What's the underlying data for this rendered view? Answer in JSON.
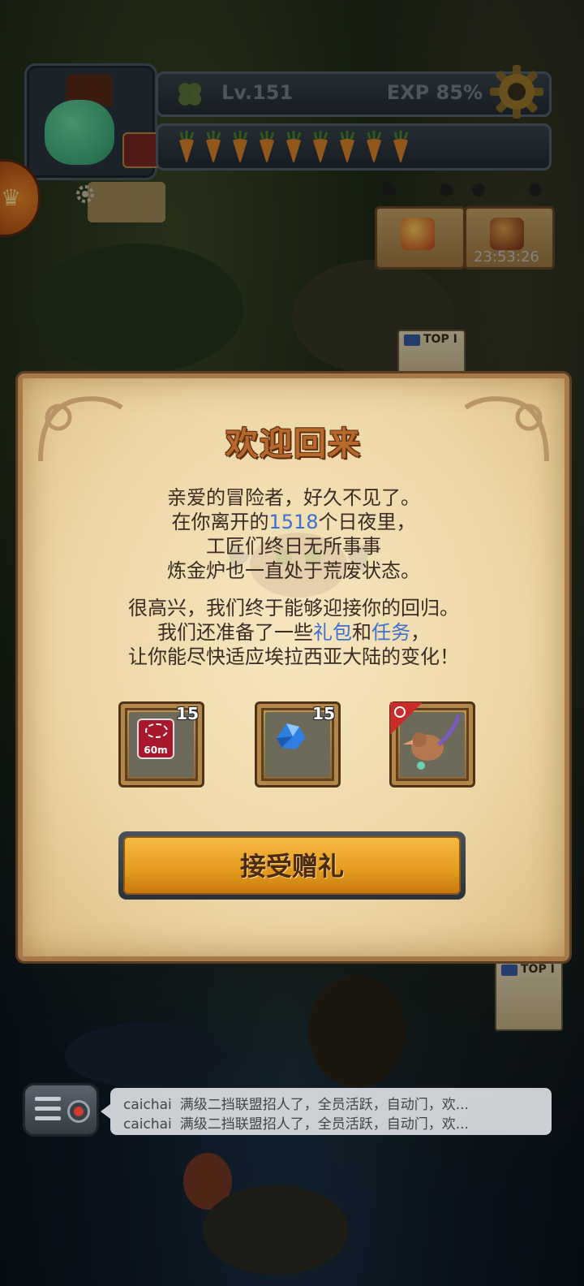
{
  "hud": {
    "level": "Lv.151",
    "exp": "EXP 85%",
    "stamina_count": 9,
    "timer": "23:53:26"
  },
  "map": {
    "top1_label_a": "TOP I",
    "top1_label_b": "TOP I"
  },
  "dialog": {
    "title": "欢迎回来",
    "p1_line1": "亲爱的冒险者，好久不见了。",
    "p1_line2_pre": "在你离开的",
    "p1_line2_days": "1518",
    "p1_line2_post": "个日夜里，",
    "p1_line3": "工匠们终日无所事事",
    "p1_line4": "炼金炉也一直处于荒废状态。",
    "p2_line1": "很高兴，我们终于能够迎接你的回归。",
    "p2_line2_pre": "我们还准备了一些",
    "p2_line2_gift": "礼包",
    "p2_line2_mid": "和",
    "p2_line2_task": "任务",
    "p2_line2_post": "，",
    "p2_line3": "让你能尽快适应埃拉西亚大陆的变化！",
    "gifts": [
      {
        "icon": "timer-ticket-icon",
        "badge": "60m",
        "count": "15"
      },
      {
        "icon": "blue-crystal-icon",
        "count": "15"
      },
      {
        "icon": "bird-pet-icon"
      }
    ],
    "accept_label": "接受赠礼"
  },
  "chat": {
    "messages": [
      {
        "user": "caichai",
        "text": "满级二挡联盟招人了，全员活跃，自动门，欢..."
      },
      {
        "user": "caichai",
        "text": "满级二挡联盟招人了，全员活跃，自动门，欢..."
      }
    ]
  },
  "colors": {
    "highlight": "#3b6fd1",
    "title": "#b7682a",
    "button": "#f0aa30"
  }
}
